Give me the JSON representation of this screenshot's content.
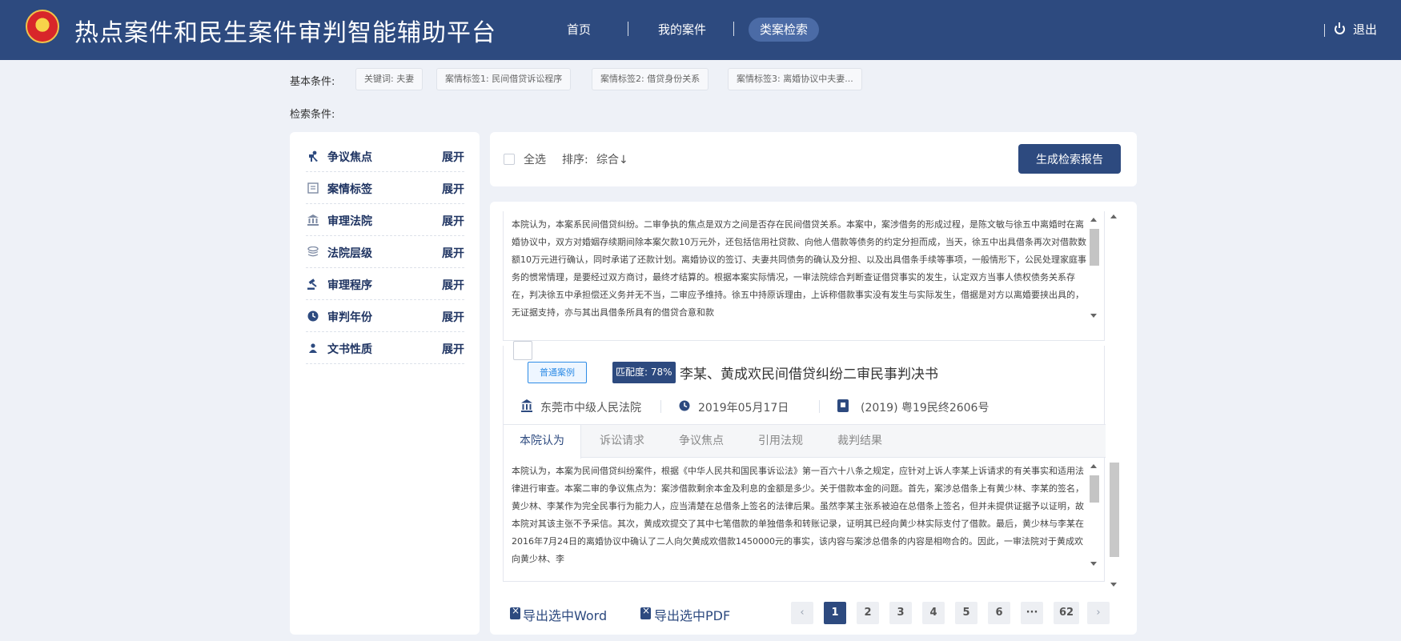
{
  "header": {
    "title": "热点案件和民生案件审判智能辅助平台",
    "nav": [
      "首页",
      "我的案件",
      "类案检索"
    ],
    "logout": "退出"
  },
  "conditions": {
    "basic_label": "基本条件:",
    "search_label": "检索条件:",
    "tags": [
      "关键词: 夫妻",
      "案情标签1: 民间借贷诉讼程序",
      "案情标签2: 借贷身份关系",
      "案情标签3: 离婚协议中夫妻..."
    ]
  },
  "filters": {
    "items": [
      {
        "label": "争议焦点",
        "icon": "gavel-people-icon"
      },
      {
        "label": "案情标签",
        "icon": "document-icon"
      },
      {
        "label": "审理法院",
        "icon": "court-icon"
      },
      {
        "label": "法院层级",
        "icon": "layers-icon"
      },
      {
        "label": "审理程序",
        "icon": "gavel-icon"
      },
      {
        "label": "审判年份",
        "icon": "clock-icon"
      },
      {
        "label": "文书性质",
        "icon": "person-icon"
      }
    ],
    "expand_label": "展开"
  },
  "toolbar": {
    "select_all": "全选",
    "sort_label": "排序:",
    "sort_value": "综合↓",
    "report_button": "生成检索报告"
  },
  "results": {
    "first_excerpt": "本院认为，本案系民间借贷纠纷。二审争执的焦点是双方之间是否存在民间借贷关系。本案中，案涉借务的形成过程，是陈文敏与徐五中离婚时在离婚协议中，双方对婚姻存续期间除本案欠款10万元外，还包括信用社贷款、向他人借款等债务的约定分担而成，当天，徐五中出具借条再次对借款数额10万元进行确认，同时承诺了还款计划。离婚协议的签订、夫妻共同债务的确认及分担、以及出具借条手续等事项，一般情形下，公民处理家庭事务的惯常情理，是要经过双方商讨，最终才结算的。根据本案实际情况，一审法院综合判断查证借贷事实的发生，认定双方当事人债权债务关系存在，判决徐五中承担偿还义务并无不当，二审应予维持。徐五中持原诉理由，上诉称借款事实没有发生与实际发生，借据是对方以离婚要挟出具的，无证据支持，亦与其出具借条所具有的借贷合意和款",
    "card": {
      "type_tag": "普通案例",
      "match_tag": "匹配度: 78%",
      "title": "李某、黄成欢民间借贷纠纷二审民事判决书",
      "court": "东莞市中级人民法院",
      "date": "2019年05月17日",
      "case_no": "(2019) 粤19民终2606号",
      "tabs": [
        "本院认为",
        "诉讼请求",
        "争议焦点",
        "引用法规",
        "裁判结果"
      ],
      "excerpt": "本院认为，本案为民间借贷纠纷案件，根据《中华人民共和国民事诉讼法》第一百六十八条之规定，应针对上诉人李某上诉请求的有关事实和适用法律进行审查。本案二审的争议焦点为：案涉借款剩余本金及利息的金额是多少。关于借款本金的问题。首先，案涉总借条上有黄少林、李某的签名，黄少林、李某作为完全民事行为能力人，应当清楚在总借条上签名的法律后果。虽然李某主张系被迫在总借条上签名，但并未提供证据予以证明，故本院对其该主张不予采信。其次，黄成欢提交了其中七笔借款的单独借条和转账记录，证明其已经向黄少林实际支付了借款。最后，黄少林与李某在2016年7月24日的离婚协议中确认了二人向欠黄成欢借款1450000元的事实，该内容与案涉总借条的内容是相吻合的。因此，一审法院对于黄成欢向黄少林、李"
    },
    "export_word": "导出选中Word",
    "export_pdf": "导出选中PDF",
    "pages": [
      "1",
      "2",
      "3",
      "4",
      "5",
      "6",
      "···",
      "62"
    ],
    "current_page": "1"
  }
}
